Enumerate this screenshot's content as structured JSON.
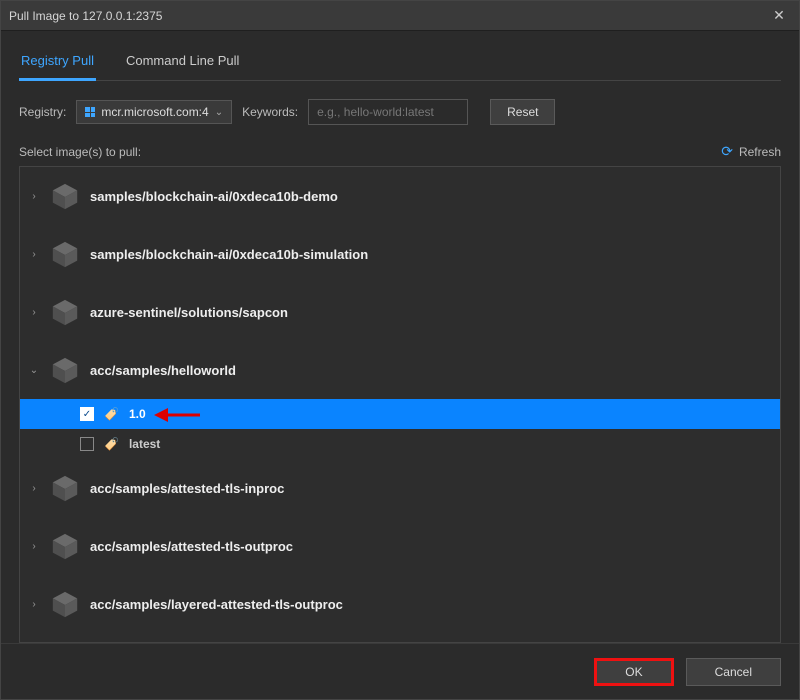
{
  "window": {
    "title": "Pull Image to 127.0.0.1:2375"
  },
  "tabs": {
    "registry": "Registry Pull",
    "cli": "Command Line Pull"
  },
  "filters": {
    "registry_label": "Registry:",
    "registry_value": "mcr.microsoft.com:4",
    "keywords_label": "Keywords:",
    "keywords_placeholder": "e.g., hello-world:latest",
    "reset": "Reset"
  },
  "list_header": {
    "select_label": "Select image(s) to pull:",
    "refresh": "Refresh"
  },
  "images": [
    {
      "name": "samples/blockchain-ai/0xdeca10b-demo",
      "expanded": false
    },
    {
      "name": "samples/blockchain-ai/0xdeca10b-simulation",
      "expanded": false
    },
    {
      "name": "azure-sentinel/solutions/sapcon",
      "expanded": false
    },
    {
      "name": "acc/samples/helloworld",
      "expanded": true,
      "tags": [
        {
          "name": "1.0",
          "checked": true,
          "selected": true
        },
        {
          "name": "latest",
          "checked": false,
          "selected": false
        }
      ]
    },
    {
      "name": "acc/samples/attested-tls-inproc",
      "expanded": false
    },
    {
      "name": "acc/samples/attested-tls-outproc",
      "expanded": false
    },
    {
      "name": "acc/samples/layered-attested-tls-outproc",
      "expanded": false
    }
  ],
  "footer": {
    "ok": "OK",
    "cancel": "Cancel"
  }
}
